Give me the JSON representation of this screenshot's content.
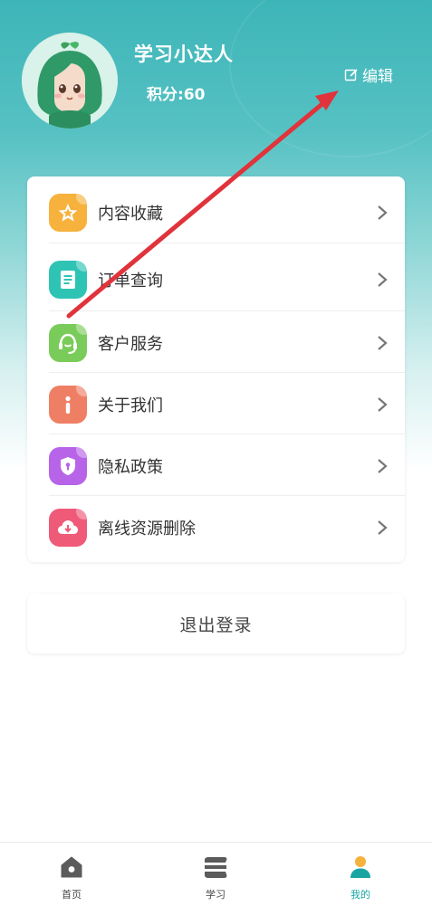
{
  "profile": {
    "username": "学习小达人",
    "points": "积分:60",
    "edit_label": "编辑"
  },
  "menu": {
    "items": [
      {
        "label": "内容收藏",
        "icon": "star-icon",
        "color": "#f6b23c"
      },
      {
        "label": "订单查询",
        "icon": "document-icon",
        "color": "#2ec4b4"
      },
      {
        "label": "客户服务",
        "icon": "headset-icon",
        "color": "#7acc5a"
      },
      {
        "label": "关于我们",
        "icon": "info-icon",
        "color": "#ef7f64"
      },
      {
        "label": "隐私政策",
        "icon": "shield-icon",
        "color": "#b764e8"
      },
      {
        "label": "离线资源删除",
        "icon": "cloud-download-icon",
        "color": "#ef5a78"
      }
    ]
  },
  "logout_label": "退出登录",
  "tabs": [
    {
      "label": "首页",
      "icon": "home-icon",
      "active": false
    },
    {
      "label": "学习",
      "icon": "stack-icon",
      "active": false
    },
    {
      "label": "我的",
      "icon": "person-icon",
      "active": true
    }
  ],
  "colors": {
    "accent": "#1aa5a2",
    "header_top": "#3db5b8",
    "annotation_arrow": "#e0333b"
  }
}
